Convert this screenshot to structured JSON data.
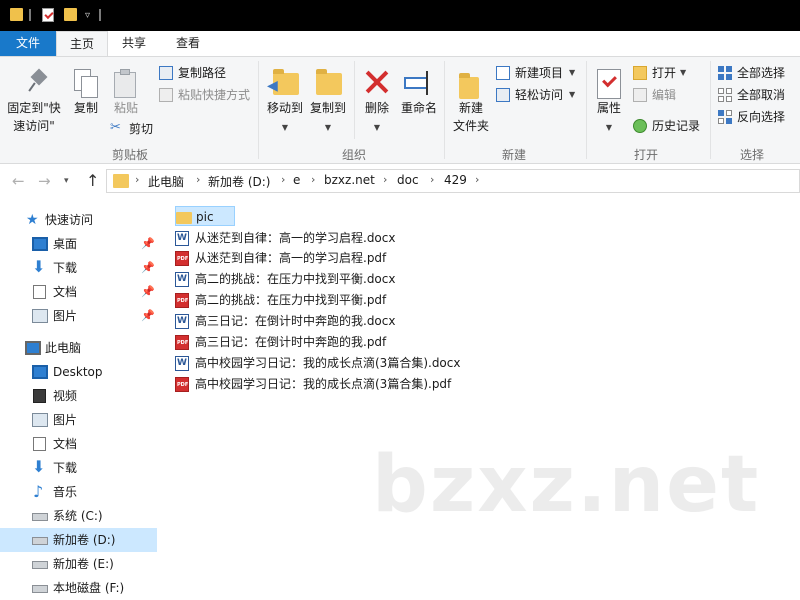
{
  "tabs": {
    "file": "文件",
    "home": "主页",
    "share": "共享",
    "view": "查看"
  },
  "ribbon": {
    "clipboard": {
      "group_label": "剪贴板",
      "pin_label_1": "固定到\"快",
      "pin_label_2": "速访问\"",
      "copy": "复制",
      "paste": "粘贴",
      "copy_path": "复制路径",
      "paste_shortcut": "粘贴快捷方式",
      "cut": "剪切"
    },
    "organize": {
      "group_label": "组织",
      "move_to": "移动到",
      "copy_to": "复制到",
      "delete": "删除",
      "rename": "重命名"
    },
    "new": {
      "group_label": "新建",
      "new_folder_1": "新建",
      "new_folder_2": "文件夹",
      "new_item": "新建项目",
      "easy_access": "轻松访问"
    },
    "open": {
      "group_label": "打开",
      "properties": "属性",
      "open": "打开",
      "edit": "编辑",
      "history": "历史记录"
    },
    "select": {
      "group_label": "选择",
      "select_all": "全部选择",
      "select_none": "全部取消",
      "invert": "反向选择"
    }
  },
  "breadcrumb": [
    "此电脑",
    "新加卷 (D:)",
    "e",
    "bzxz.net",
    "doc",
    "429"
  ],
  "sidebar": {
    "quick_access": "快速访问",
    "quick_items": [
      {
        "label": "桌面",
        "icon": "desktop-icon"
      },
      {
        "label": "下载",
        "icon": "download-icon"
      },
      {
        "label": "文档",
        "icon": "document-icon"
      },
      {
        "label": "图片",
        "icon": "picture-icon"
      }
    ],
    "this_pc": "此电脑",
    "pc_items": [
      {
        "label": "Desktop",
        "icon": "desktop-icon"
      },
      {
        "label": "视频",
        "icon": "video-icon"
      },
      {
        "label": "图片",
        "icon": "picture-icon"
      },
      {
        "label": "文档",
        "icon": "document-icon"
      },
      {
        "label": "下载",
        "icon": "download-icon"
      },
      {
        "label": "音乐",
        "icon": "music-icon"
      },
      {
        "label": "系统 (C:)",
        "icon": "drive-icon"
      },
      {
        "label": "新加卷 (D:)",
        "icon": "drive-icon",
        "selected": true
      },
      {
        "label": "新加卷 (E:)",
        "icon": "drive-icon"
      },
      {
        "label": "本地磁盘 (F:)",
        "icon": "drive-icon"
      }
    ]
  },
  "files": [
    {
      "name": "pic",
      "type": "folder",
      "selected": true
    },
    {
      "name": "从迷茫到自律：高一的学习启程.docx",
      "type": "docx"
    },
    {
      "name": "从迷茫到自律：高一的学习启程.pdf",
      "type": "pdf"
    },
    {
      "name": "高二的挑战：在压力中找到平衡.docx",
      "type": "docx"
    },
    {
      "name": "高二的挑战：在压力中找到平衡.pdf",
      "type": "pdf"
    },
    {
      "name": "高三日记：在倒计时中奔跑的我.docx",
      "type": "docx"
    },
    {
      "name": "高三日记：在倒计时中奔跑的我.pdf",
      "type": "pdf"
    },
    {
      "name": "高中校园学习日记：我的成长点滴(3篇合集).docx",
      "type": "docx"
    },
    {
      "name": "高中校园学习日记：我的成长点滴(3篇合集).pdf",
      "type": "pdf"
    }
  ],
  "watermark": "bzxz.net",
  "colors": {
    "accent": "#1979ca",
    "selection": "#cce8ff",
    "ribbon_bg": "#f5f6f7",
    "folder": "#f3c85d",
    "delete_red": "#d32f2f"
  }
}
